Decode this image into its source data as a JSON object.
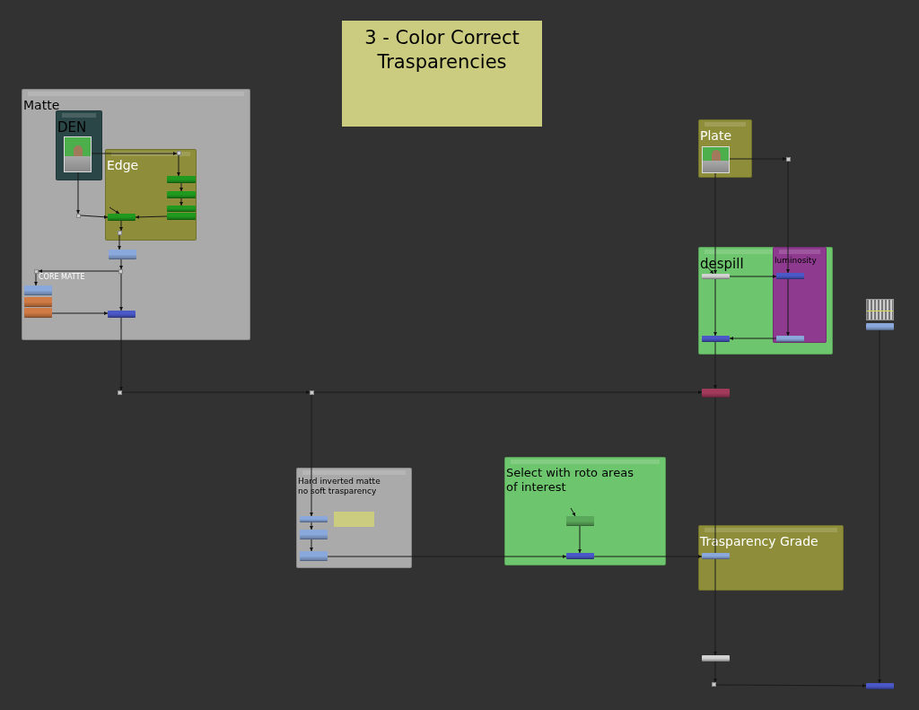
{
  "sticky_note": {
    "title": "3 - Color Correct\nTrasparencies",
    "color": "#cccc80"
  },
  "backdrops": [
    {
      "label": "Matte",
      "color": "#aaaaaa",
      "light_label": false
    },
    {
      "label": "DEN",
      "color": "#2b4646",
      "light_label": false
    },
    {
      "label": "Edge",
      "color": "#8e8e3a",
      "light_label": true
    },
    {
      "label": "Plate",
      "color": "#8e8e3a",
      "light_label": true
    },
    {
      "label": "despill",
      "color": "#6dc56d",
      "light_label": false
    },
    {
      "label": "luminosity",
      "color": "#8e3a8e",
      "light_label": false
    },
    {
      "label": "Hard inverted matte\nno soft trasparency",
      "color": "#aaaaaa",
      "light_label": false
    },
    {
      "label": "Select with roto areas\nof interest",
      "color": "#6dc56d",
      "light_label": false
    },
    {
      "label": "Trasparency Grade",
      "color": "#8e8e3a",
      "light_label": true
    }
  ],
  "texts": [
    {
      "text": "CORE MATTE"
    }
  ],
  "nodes": [
    {
      "kind": "read",
      "color": "#4caf4c"
    },
    {
      "kind": "read",
      "color": "#4caf4c"
    },
    {
      "kind": "checker"
    },
    {
      "kind": "node",
      "color": "#8aa8dc"
    },
    {
      "kind": "node",
      "color": "#1f9a1f"
    },
    {
      "kind": "node",
      "color": "#1f9a1f"
    },
    {
      "kind": "node",
      "color": "#1f9a1f"
    },
    {
      "kind": "node",
      "color": "#1f9a1f"
    },
    {
      "kind": "node",
      "color": "#1f9a1f"
    },
    {
      "kind": "node",
      "color": "#8aa8dc"
    },
    {
      "kind": "node",
      "color": "#8aa8dc"
    },
    {
      "kind": "node",
      "color": "#d07a45"
    },
    {
      "kind": "node",
      "color": "#d07a45"
    },
    {
      "kind": "node",
      "color": "#4a58c8"
    },
    {
      "kind": "node",
      "color": "#d2d2d2"
    },
    {
      "kind": "node",
      "color": "#4a58c8"
    },
    {
      "kind": "node",
      "color": "#4a58c8"
    },
    {
      "kind": "node",
      "color": "#8aa8dc"
    },
    {
      "kind": "node",
      "color": "#a23a5c"
    },
    {
      "kind": "node",
      "color": "#8aa8dc"
    },
    {
      "kind": "node",
      "color": "#8aa8dc"
    },
    {
      "kind": "node",
      "color": "#8aa8dc"
    },
    {
      "kind": "sticky",
      "color": "#cccc80"
    },
    {
      "kind": "node",
      "color": "#5aa85a"
    },
    {
      "kind": "node",
      "color": "#4a58c8"
    },
    {
      "kind": "node",
      "color": "#8aa8dc"
    },
    {
      "kind": "node",
      "color": "#d2d2d2"
    },
    {
      "kind": "node",
      "color": "#4a58c8"
    },
    {
      "kind": "dot",
      "color": "#cccccc"
    },
    {
      "kind": "dot",
      "color": "#cccccc"
    },
    {
      "kind": "dot",
      "color": "#cccccc"
    },
    {
      "kind": "dot",
      "color": "#cccccc"
    },
    {
      "kind": "dot",
      "color": "#cccccc"
    },
    {
      "kind": "dot",
      "color": "#cccccc"
    },
    {
      "kind": "dot",
      "color": "#cccccc"
    },
    {
      "kind": "dot",
      "color": "#cccccc"
    },
    {
      "kind": "dot",
      "color": "#cccccc"
    }
  ]
}
